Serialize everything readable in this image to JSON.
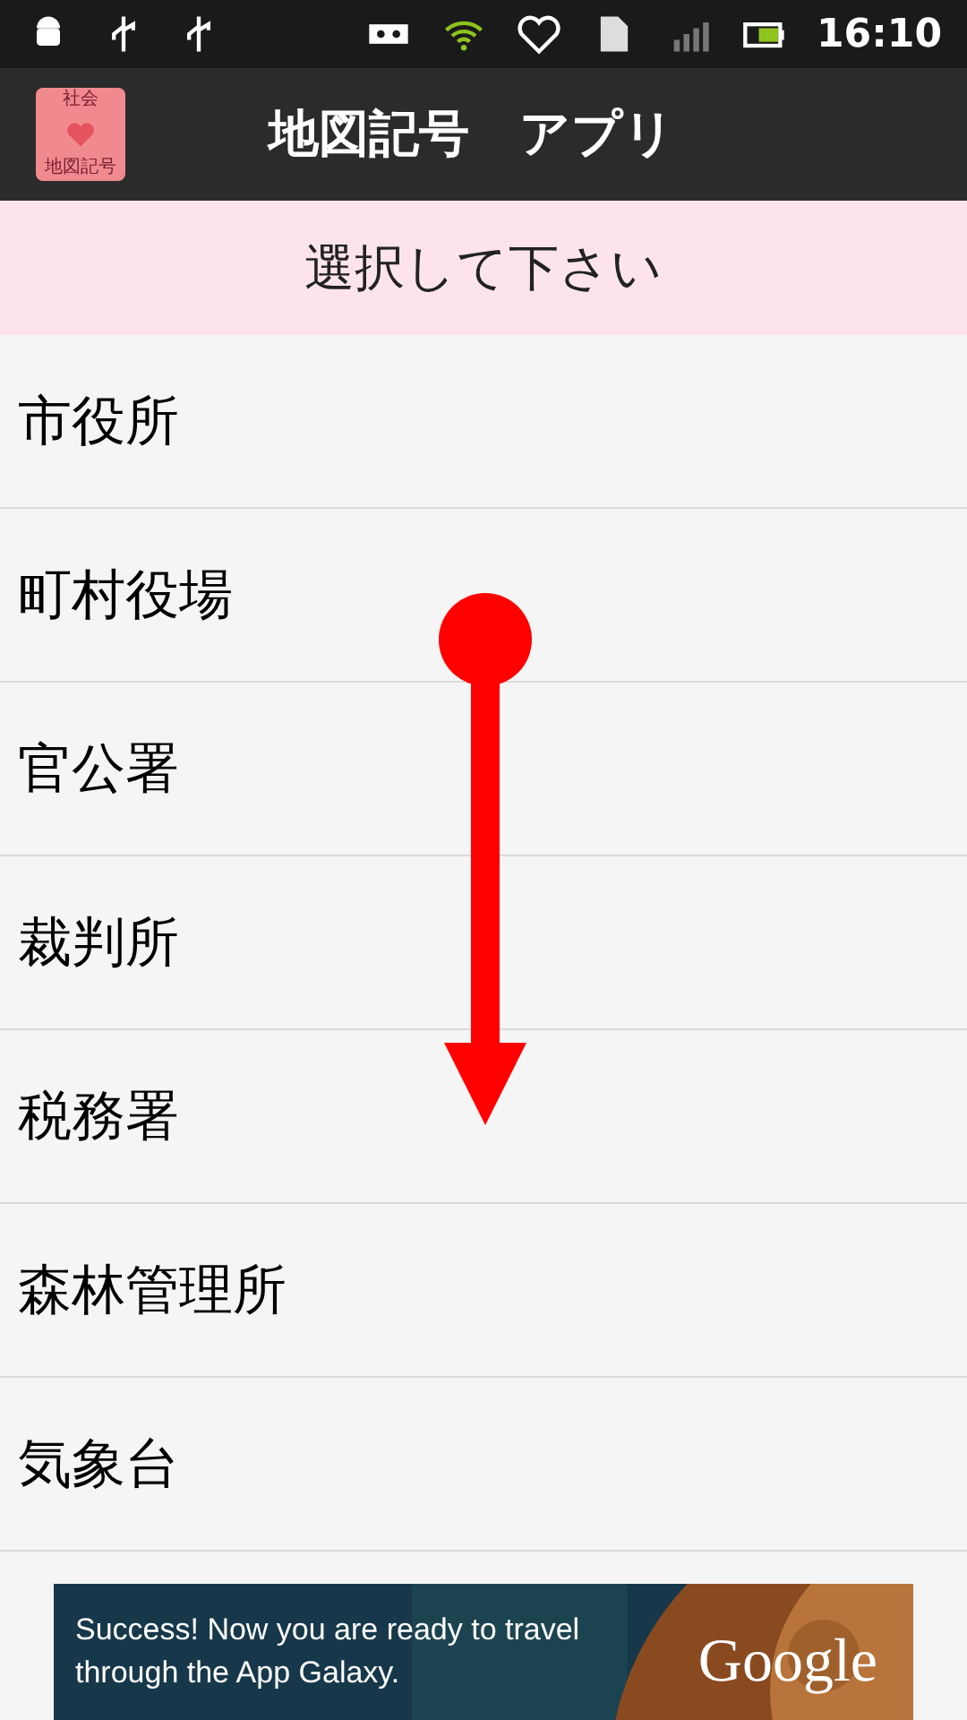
{
  "status_bar": {
    "time": "16:10"
  },
  "app_bar": {
    "icon_top": "社会",
    "icon_bottom": "地図記号",
    "title": "地図記号　アプリ"
  },
  "header": "選択して下さい",
  "items": [
    {
      "label": "市役所"
    },
    {
      "label": "町村役場"
    },
    {
      "label": "官公署"
    },
    {
      "label": "裁判所"
    },
    {
      "label": "税務署"
    },
    {
      "label": "森林管理所"
    },
    {
      "label": "気象台"
    }
  ],
  "ad": {
    "text": "Success! Now you are ready to travel through the App Galaxy.",
    "brand": "Google"
  }
}
